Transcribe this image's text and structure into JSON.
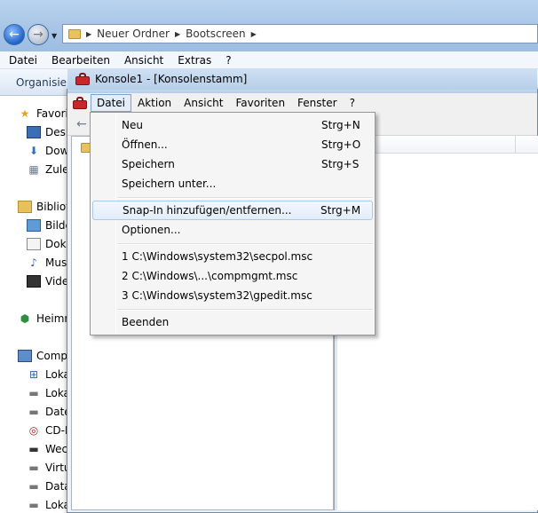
{
  "explorer": {
    "breadcrumbs": [
      "Neuer Ordner",
      "Bootscreen"
    ],
    "menubar": [
      "Datei",
      "Bearbeiten",
      "Ansicht",
      "Extras",
      "?"
    ],
    "toolbar_label": "Organisiere",
    "sidebar": {
      "favorites_label": "Favorit",
      "favorites": [
        {
          "label": "Desk",
          "icon": "desktop-icon"
        },
        {
          "label": "Dow",
          "icon": "downloads-icon"
        },
        {
          "label": "Zule",
          "icon": "recent-places-icon"
        }
      ],
      "libraries_label": "Bibliot",
      "libraries": [
        {
          "label": "Bilde",
          "icon": "pictures-icon"
        },
        {
          "label": "Doku",
          "icon": "documents-icon"
        },
        {
          "label": "Musi",
          "icon": "music-icon"
        },
        {
          "label": "Vide",
          "icon": "videos-icon"
        }
      ],
      "homegroup_label": "Heimn",
      "computer_label": "Comp",
      "drives": [
        {
          "label": "Loka",
          "icon": "system-drive-icon"
        },
        {
          "label": "Loka",
          "icon": "hard-drive-icon"
        },
        {
          "label": "Date",
          "icon": "hard-drive-icon"
        },
        {
          "label": "CD-L",
          "icon": "cd-drive-icon"
        },
        {
          "label": "Wec",
          "icon": "removable-drive-icon"
        },
        {
          "label": "Virtu",
          "icon": "hard-drive-icon"
        },
        {
          "label": "Data",
          "icon": "hard-drive-icon"
        },
        {
          "label": "Loka",
          "icon": "hard-drive-icon"
        }
      ]
    }
  },
  "mmc": {
    "title": "Konsole1 - [Konsolenstamm]",
    "menubar": [
      "Datei",
      "Aktion",
      "Ansicht",
      "Favoriten",
      "Fenster",
      "?"
    ]
  },
  "datei_menu": {
    "groups": [
      [
        {
          "label": "Neu",
          "shortcut": "Strg+N"
        },
        {
          "label": "Öffnen...",
          "shortcut": "Strg+O"
        },
        {
          "label": "Speichern",
          "shortcut": "Strg+S"
        },
        {
          "label": "Speichern unter...",
          "shortcut": ""
        }
      ],
      [
        {
          "label": "Snap-In hinzufügen/entfernen...",
          "shortcut": "Strg+M",
          "highlighted": true
        },
        {
          "label": "Optionen...",
          "shortcut": ""
        }
      ],
      [
        {
          "label": "1 C:\\Windows\\system32\\secpol.msc",
          "shortcut": ""
        },
        {
          "label": "2 C:\\Windows\\...\\compmgmt.msc",
          "shortcut": ""
        },
        {
          "label": "3 C:\\Windows\\system32\\gpedit.msc",
          "shortcut": ""
        }
      ],
      [
        {
          "label": "Beenden",
          "shortcut": ""
        }
      ]
    ]
  }
}
